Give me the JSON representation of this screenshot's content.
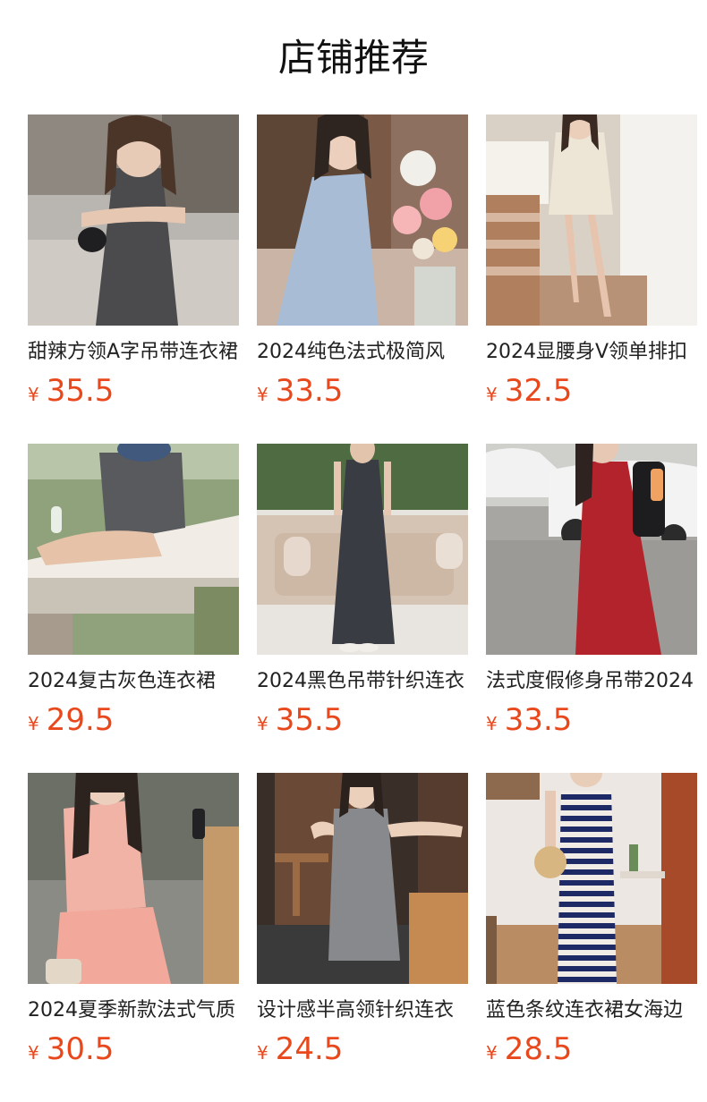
{
  "section": {
    "title": "店铺推荐"
  },
  "currency_symbol": "¥",
  "colors": {
    "price": "#e8481c"
  },
  "products": [
    {
      "title": "甜辣方领A字吊带连衣裙",
      "price": "35.5"
    },
    {
      "title": "2024纯色法式极简风",
      "price": "33.5"
    },
    {
      "title": "2024显腰身V领单排扣",
      "price": "32.5"
    },
    {
      "title": "2024复古灰色连衣裙",
      "price": "29.5"
    },
    {
      "title": "2024黑色吊带针织连衣",
      "price": "35.5"
    },
    {
      "title": "法式度假修身吊带2024",
      "price": "33.5"
    },
    {
      "title": "2024夏季新款法式气质",
      "price": "30.5"
    },
    {
      "title": "设计感半高领针织连衣",
      "price": "24.5"
    },
    {
      "title": "蓝色条纹连衣裙女海边",
      "price": "28.5"
    }
  ]
}
